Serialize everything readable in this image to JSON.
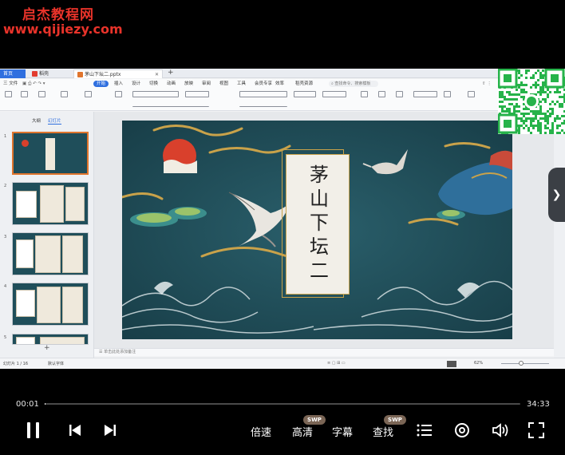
{
  "watermark": {
    "title": "启杰教程网",
    "url": "www.qijiezy.com"
  },
  "app": {
    "tabs": [
      {
        "label": "首页"
      },
      {
        "label": "稻壳"
      },
      {
        "label": "茅山下坛二.pptx"
      }
    ],
    "menu": [
      "三 文件",
      "开始",
      "插入",
      "设计",
      "切换",
      "动画",
      "放映",
      "审阅",
      "视图",
      "工具",
      "会员专享",
      "效率",
      "稻壳资源"
    ],
    "search_placeholder": "查找命令、搜索模板",
    "left_panel": {
      "tabs": [
        "大纲",
        "幻灯片"
      ]
    },
    "slide": {
      "title": "茅山下坛二"
    },
    "notes_placeholder": "单击此处添加备注",
    "status": {
      "slide_counter": "幻灯片 1 / 16",
      "theme": "默认字体",
      "zoom": "62%"
    }
  },
  "player": {
    "current_time": "00:01",
    "total_time": "34:33",
    "progress": 0.0005,
    "buttons": {
      "speed": "倍速",
      "quality": "高清",
      "subtitles": "字幕",
      "search": "查找"
    },
    "badges": {
      "swp": "SWP"
    }
  },
  "colors": {
    "accent": "#2f6fdf",
    "watermark": "#e8332a",
    "slide_bg": "#1f4c58",
    "sun": "#d9402c",
    "gold": "#c9a24a",
    "qr": "#26b34a"
  }
}
